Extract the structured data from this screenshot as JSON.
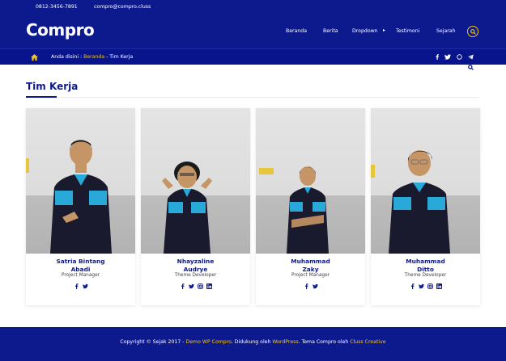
{
  "topbar": {
    "phone": "0812-3456-7891",
    "email": "compro@compro.cluss"
  },
  "header": {
    "logo": "Compro",
    "nav": [
      "Beranda",
      "Berita",
      "Dropdown",
      "Testimoni",
      "Sejarah"
    ]
  },
  "breadcrumb": {
    "prefix": "Anda disini :",
    "home": "Beranda",
    "separator": "-",
    "current": "Tim Kerja"
  },
  "page": {
    "title": "Tim Kerja"
  },
  "team": [
    {
      "name_line1": "Satria Bintang",
      "name_line2": "Abadi",
      "role": "Project Manager",
      "socials": [
        "facebook-icon",
        "twitter-icon"
      ]
    },
    {
      "name_line1": "Nhayzaline",
      "name_line2": "Audrye",
      "role": "Theme Developer",
      "socials": [
        "facebook-icon",
        "twitter-icon",
        "instagram-icon",
        "linkedin-icon"
      ]
    },
    {
      "name_line1": "Muhammad",
      "name_line2": "Zaky",
      "role": "Project Manager",
      "socials": [
        "facebook-icon",
        "twitter-icon"
      ]
    },
    {
      "name_line1": "Muhammad",
      "name_line2": "Ditto",
      "role": "Theme Developer",
      "socials": [
        "facebook-icon",
        "twitter-icon",
        "instagram-icon",
        "linkedin-icon"
      ]
    }
  ],
  "footer": {
    "prefix": "Copyright © Sejak 2017 -",
    "link1": "Demo WP Compro",
    "mid1": ". Didukung oleh",
    "link2": "WordPress",
    "mid2": ". Tema Compro oleh",
    "link3": "Cluss Creative"
  },
  "colors": {
    "primary": "#0d1a8e",
    "accent": "#f0c419",
    "shirt": "#1a1a2e",
    "shirt_accent": "#29a9d8"
  }
}
